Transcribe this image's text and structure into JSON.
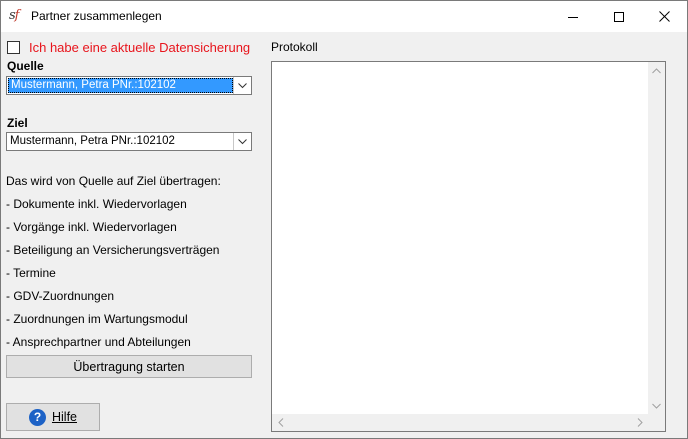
{
  "window": {
    "title": "Partner zusammenlegen",
    "icon_text_s": "s",
    "icon_text_f": "f"
  },
  "backup": {
    "label": "Ich habe eine aktuelle Datensicherung",
    "checked": false,
    "color": "#e8141c"
  },
  "source": {
    "label": "Quelle",
    "value": "Mustermann, Petra PNr.:102102"
  },
  "target": {
    "label": "Ziel",
    "value": "Mustermann, Petra PNr.:102102"
  },
  "info": {
    "heading": "Das wird von Quelle auf Ziel übertragen:",
    "items": [
      "- Dokumente inkl. Wiedervorlagen",
      "- Vorgänge inkl. Wiedervorlagen",
      "- Beteiligung an Versicherungsverträgen",
      "- Termine",
      "- GDV-Zuordnungen",
      "- Zuordnungen im Wartungsmodul",
      "- Ansprechpartner und Abteilungen"
    ]
  },
  "actions": {
    "start_label": "Übertragung starten",
    "help_label": "Hilfe",
    "help_icon_glyph": "?"
  },
  "protokoll": {
    "label": "Protokoll",
    "content": ""
  }
}
